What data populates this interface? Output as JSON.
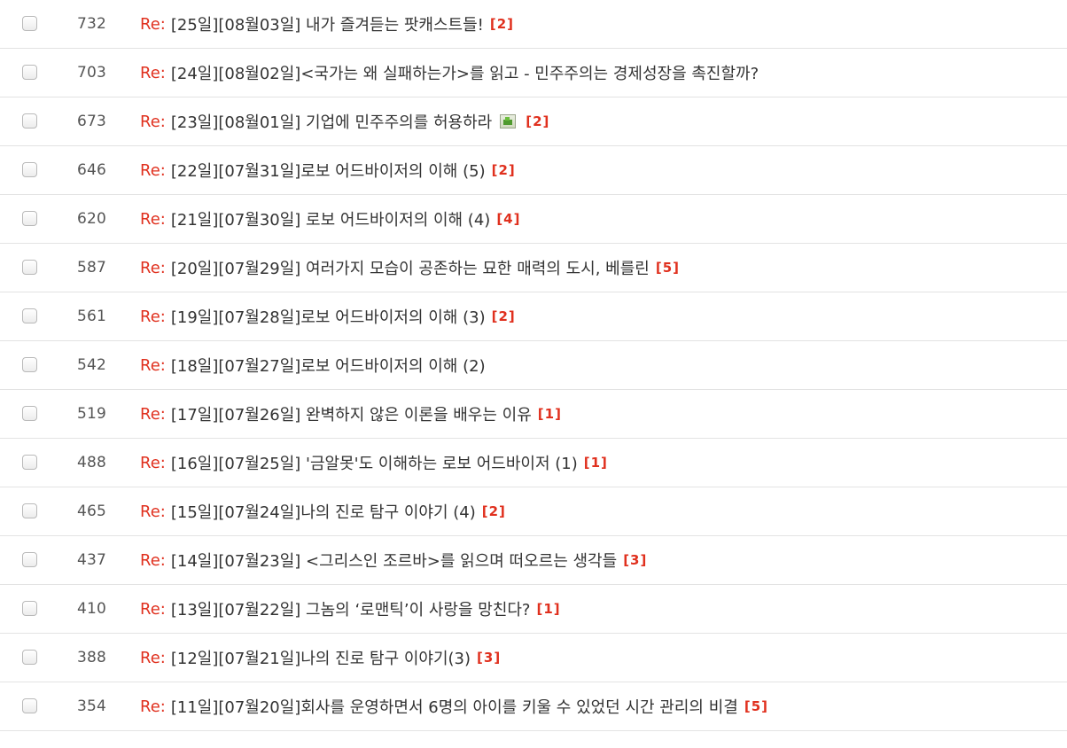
{
  "re_prefix": "Re:",
  "posts": [
    {
      "number": "732",
      "title": "[25일][08월03일] 내가 즐겨듣는 팟캐스트들!",
      "comments": "[2]",
      "has_image": false
    },
    {
      "number": "703",
      "title": "[24일][08월02일]<국가는 왜 실패하는가>를 읽고 - 민주주의는 경제성장을 촉진할까?",
      "comments": "",
      "has_image": false
    },
    {
      "number": "673",
      "title": "[23일][08월01일] 기업에 민주주의를 허용하라",
      "comments": "[2]",
      "has_image": true
    },
    {
      "number": "646",
      "title": "[22일][07월31일]로보 어드바이저의 이해 (5)",
      "comments": "[2]",
      "has_image": false
    },
    {
      "number": "620",
      "title": "[21일][07월30일] 로보 어드바이저의 이해 (4)",
      "comments": "[4]",
      "has_image": false
    },
    {
      "number": "587",
      "title": "[20일][07월29일] 여러가지 모습이 공존하는 묘한 매력의 도시, 베를린",
      "comments": "[5]",
      "has_image": false
    },
    {
      "number": "561",
      "title": "[19일][07월28일]로보 어드바이저의 이해 (3)",
      "comments": "[2]",
      "has_image": false
    },
    {
      "number": "542",
      "title": "[18일][07월27일]로보 어드바이저의 이해 (2)",
      "comments": "",
      "has_image": false
    },
    {
      "number": "519",
      "title": "[17일][07월26일] 완벽하지 않은 이론을 배우는 이유",
      "comments": "[1]",
      "has_image": false
    },
    {
      "number": "488",
      "title": "[16일][07월25일] '금알못'도 이해하는 로보 어드바이저 (1)",
      "comments": "[1]",
      "has_image": false
    },
    {
      "number": "465",
      "title": "[15일][07월24일]나의 진로 탐구 이야기 (4)",
      "comments": "[2]",
      "has_image": false
    },
    {
      "number": "437",
      "title": "[14일][07월23일] <그리스인 조르바>를 읽으며 떠오르는 생각들",
      "comments": "[3]",
      "has_image": false
    },
    {
      "number": "410",
      "title": "[13일][07월22일] 그놈의 ‘로맨틱’이 사랑을 망친다?",
      "comments": "[1]",
      "has_image": false
    },
    {
      "number": "388",
      "title": "[12일][07월21일]나의 진로 탐구 이야기(3)",
      "comments": "[3]",
      "has_image": false
    },
    {
      "number": "354",
      "title": "[11일][07월20일]회사를 운영하면서 6명의 아이를 키울 수 있었던 시간 관리의 비결",
      "comments": "[5]",
      "has_image": false
    }
  ],
  "colors": {
    "re_prefix": "#e0301e",
    "comment_count": "#e0301e",
    "title_text": "#333333",
    "number_text": "#555555",
    "row_divider": "#e3e3e3"
  },
  "icons": {
    "attachment": "image-attachment-icon",
    "checkbox": "checkbox"
  }
}
